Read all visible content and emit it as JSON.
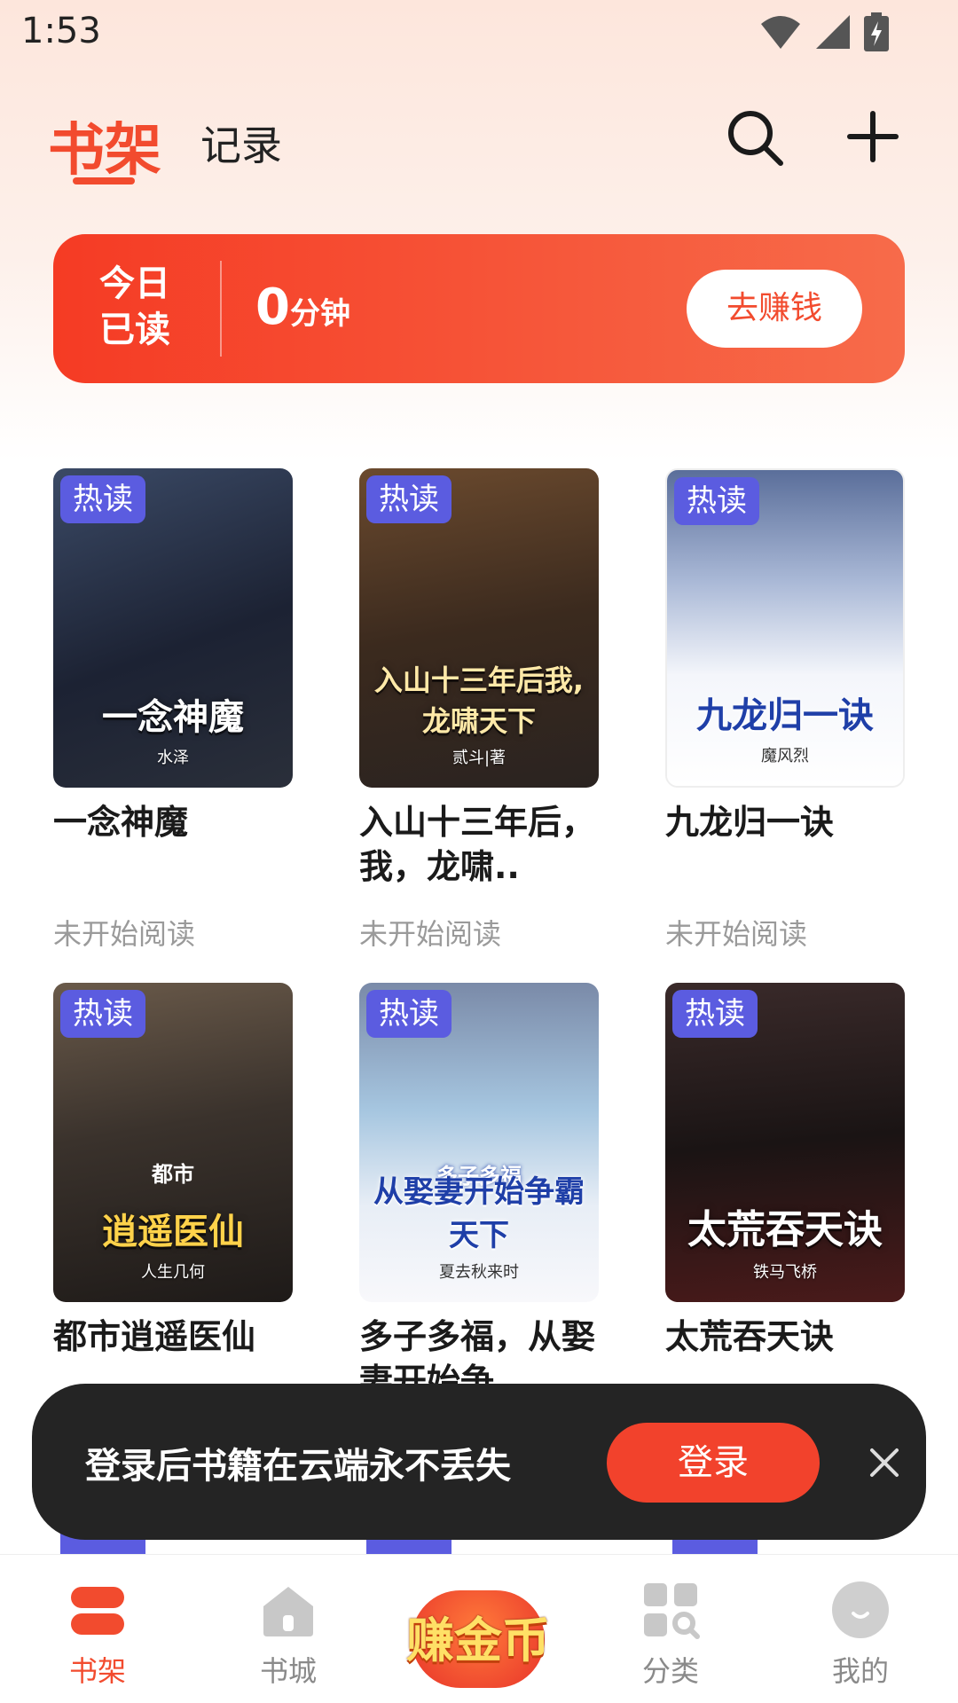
{
  "status_bar": {
    "time": "1:53"
  },
  "header": {
    "tabs": [
      {
        "label": "书架",
        "active": true
      },
      {
        "label": "记录",
        "active": false
      }
    ]
  },
  "reading_banner": {
    "label": "今日已读",
    "minutes_value": "0",
    "minutes_unit": "分钟",
    "button_label": "去赚钱"
  },
  "books": [
    {
      "title": "一念神魔",
      "status": "未开始阅读",
      "tag": "热读",
      "cover_text": "一念神魔",
      "cover_author": "水泽"
    },
    {
      "title": "入山十三年后，我，龙啸..",
      "status": "未开始阅读",
      "tag": "热读",
      "cover_text": "入山十三年后我,龙啸天下",
      "cover_author": "贰斗|著"
    },
    {
      "title": "九龙归一诀",
      "status": "未开始阅读",
      "tag": "热读",
      "cover_text": "九龙归一诀",
      "cover_author": "魔风烈"
    },
    {
      "title": "都市逍遥医仙",
      "status": "",
      "tag": "热读",
      "cover_text": "逍遥医仙",
      "cover_sub": "都市",
      "cover_author": "人生几何"
    },
    {
      "title": "多子多福，从娶妻开始争",
      "status": "",
      "tag": "热读",
      "cover_text": "从娶妻开始争霸天下",
      "cover_sub": "多子多福",
      "cover_author": "夏去秋来时"
    },
    {
      "title": "太荒吞天诀",
      "status": "",
      "tag": "热读",
      "cover_text": "太荒吞天诀",
      "cover_author": "铁马飞桥"
    }
  ],
  "toast": {
    "message": "登录后书籍在云端永不丢失",
    "login_label": "登录"
  },
  "bottom_nav": {
    "items": [
      {
        "label": "书架",
        "icon": "shelf-icon",
        "active": true
      },
      {
        "label": "书城",
        "icon": "home-icon",
        "active": false
      },
      {
        "label": "赚金币",
        "icon": "coin-icon",
        "active": false
      },
      {
        "label": "分类",
        "icon": "category-icon",
        "active": false
      },
      {
        "label": "我的",
        "icon": "profile-icon",
        "active": false
      }
    ]
  },
  "colors": {
    "accent": "#f24b2e",
    "tag": "#5b5ce0",
    "toast_bg": "#242424"
  }
}
